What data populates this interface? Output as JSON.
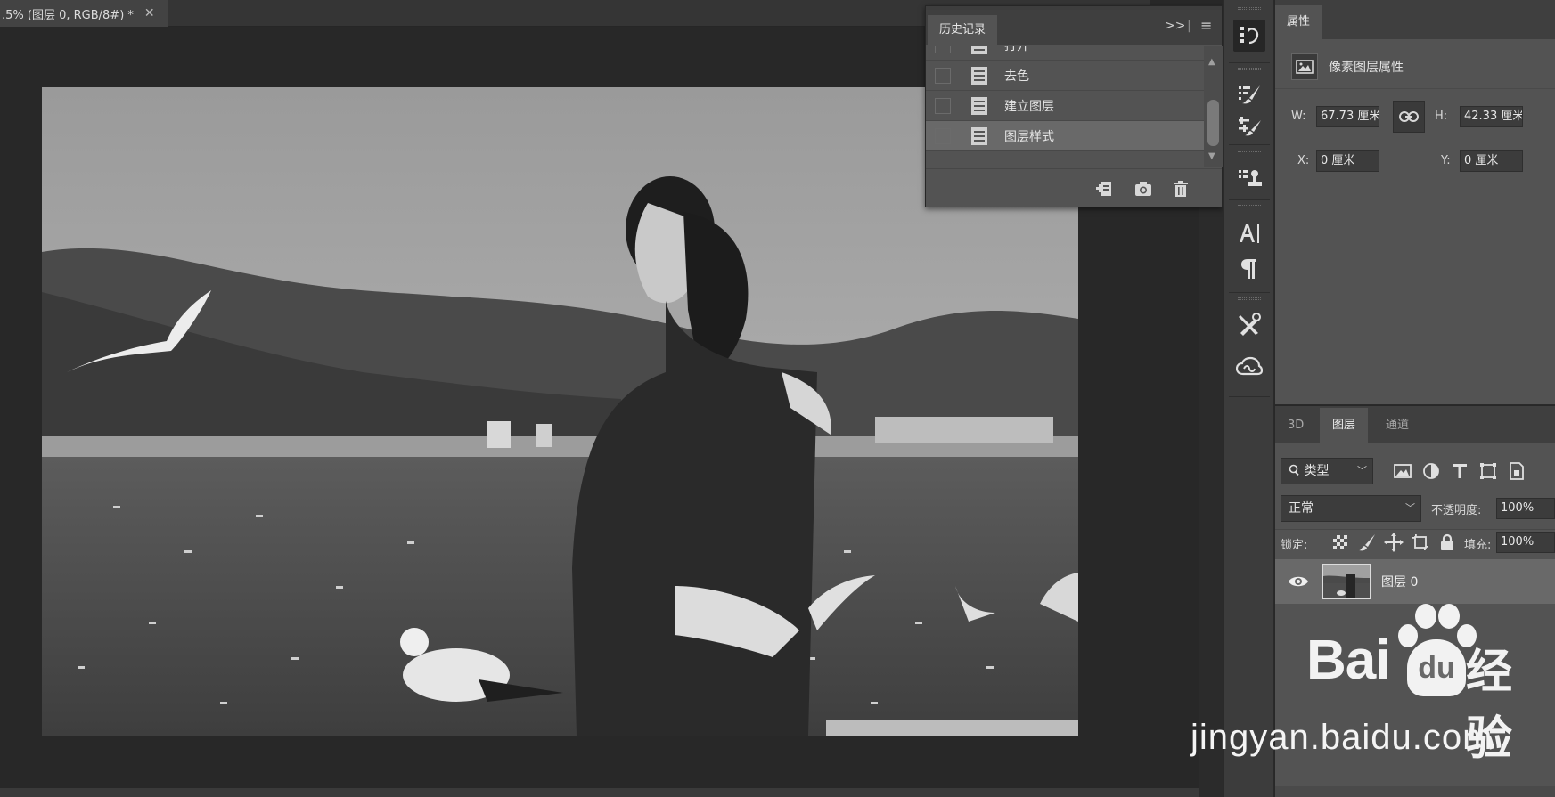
{
  "document": {
    "tab_title": ".5% (图层 0, RGB/8#) *",
    "close_glyph": "✕"
  },
  "history": {
    "tab_label": "历史记录",
    "expand_glyph": ">>",
    "menu_glyph": "≡",
    "items": [
      {
        "label": "打开",
        "selected": false
      },
      {
        "label": "去色",
        "selected": false
      },
      {
        "label": "建立图层",
        "selected": false
      },
      {
        "label": "图层样式",
        "selected": true
      }
    ],
    "footer_icons": [
      "new-document-from-state-icon",
      "camera-snapshot-icon",
      "trash-icon"
    ]
  },
  "tools": [
    {
      "name": "history-brush-panel-icon",
      "active": true
    },
    {
      "name": "brush-presets-icon",
      "active": false
    },
    {
      "name": "brush-settings-icon",
      "active": false
    },
    {
      "name": "clone-source-icon",
      "active": false
    },
    {
      "name": "character-icon",
      "active": false
    },
    {
      "name": "paragraph-icon",
      "active": false
    },
    {
      "name": "tool-presets-icon",
      "active": false
    },
    {
      "name": "creative-cloud-libraries-icon",
      "active": false
    }
  ],
  "properties": {
    "tab_label": "属性",
    "subtitle": "像素图层属性",
    "w_label": "W:",
    "w_value": "67.73 厘米",
    "h_label": "H:",
    "h_value": "42.33 厘米",
    "x_label": "X:",
    "x_value": "0 厘米",
    "y_label": "Y:",
    "y_value": "0 厘米"
  },
  "layers": {
    "tabs": [
      {
        "label": "3D",
        "active": false
      },
      {
        "label": "图层",
        "active": true
      },
      {
        "label": "通道",
        "active": false
      }
    ],
    "filter_kind": "类型",
    "blend_mode": "正常",
    "opacity_label": "不透明度:",
    "opacity_value": "100%",
    "lock_label": "锁定:",
    "fill_label": "填充:",
    "fill_value": "100%",
    "layer_name": "图层 0"
  },
  "watermark": {
    "brand": "Bai",
    "brand_du": "du",
    "brand_cn": "经验",
    "url": "jingyan.baidu.com"
  },
  "colors": {
    "panel_bg": "#535353",
    "header_bg": "#3f3f3f",
    "canvas_bg": "#282828",
    "selected_row": "#696969"
  }
}
